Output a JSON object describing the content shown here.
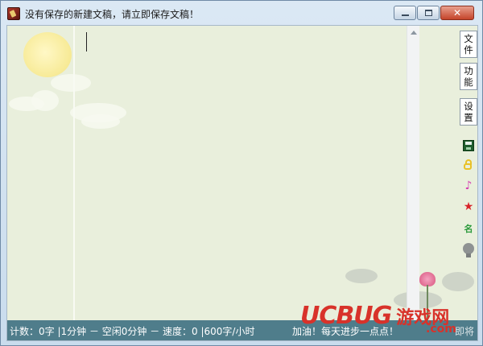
{
  "window": {
    "title": "没有保存的新建文稿，请立即保存文稿！",
    "close_glyph": "✕"
  },
  "sidebar": {
    "buttons": [
      {
        "label": [
          "文",
          "件"
        ]
      },
      {
        "label": [
          "功",
          "能"
        ]
      },
      {
        "label": [
          "设",
          "置"
        ]
      }
    ],
    "icons": [
      "save-icon",
      "lock-icon",
      "music-note-icon",
      "star-icon",
      "name-tag-icon",
      "lightbulb-icon"
    ],
    "music_glyph": "♪",
    "star_glyph": "★",
    "name_glyph": "名"
  },
  "statusbar": {
    "left": "计数：0字 |1分钟 － 空闲0分钟 － 速度：0 |600字/小时",
    "right": "加油！每天进步一点点！",
    "tail": "即将"
  },
  "watermark": {
    "logo": "UCBUG",
    "cn": "游戏网",
    "domain": ".com"
  },
  "colors": {
    "client_bg": "#e9efdc",
    "statusbar_bg": "#4f7d8b",
    "close_button": "#c5442a",
    "watermark": "#d8322a"
  }
}
